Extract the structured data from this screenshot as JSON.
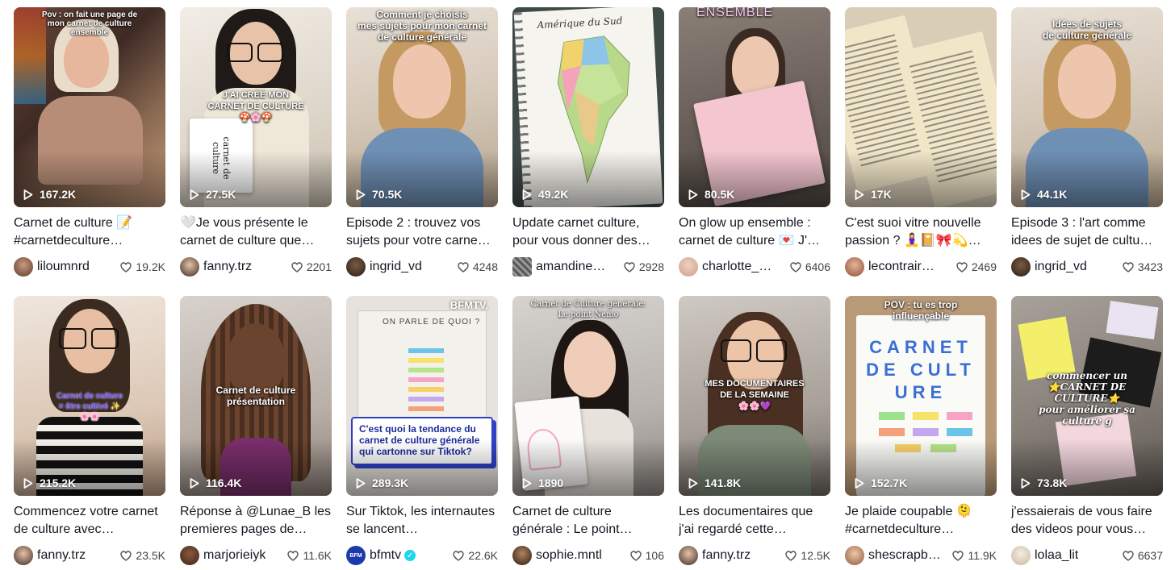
{
  "videos": [
    {
      "caption": "Carnet de culture 📝 #carnetdeculture…",
      "author": "liloumnrd",
      "likes": "19.2K",
      "views": "167.2K",
      "overlay": "Pov : on fait une page de\nmon carnet de culture\nensemble"
    },
    {
      "caption": "🤍Je vous présente le carnet de culture que…",
      "author": "fanny.trz",
      "likes": "2201",
      "views": "27.5K",
      "overlay": "J'AI CRÉÉ MON\nCARNET DE CULTURE\n🍄🌸🍄",
      "notebook_text": "carnet de culture"
    },
    {
      "caption": "Episode 2 : trouvez vos sujets pour votre carne…",
      "author": "ingrid_vd",
      "likes": "4248",
      "views": "70.5K",
      "overlay": "Comment je choisis\nmes sujets pour mon carnet\nde culture générale"
    },
    {
      "caption": "Update carnet culture, pour vous donner des…",
      "author": "amandine…",
      "likes": "2928",
      "views": "49.2K",
      "overlay": "Amérique du Sud"
    },
    {
      "caption": "On glow up ensemble : carnet de culture 💌 J'…",
      "author": "charlotte_s…",
      "likes": "6406",
      "views": "80.5K",
      "overlay": "ENSEMBLE"
    },
    {
      "caption": "C'est suoi vitre nouvelle passion ? 🧘‍♀️📔🎀💫…",
      "author": "lecontraire…",
      "likes": "2469",
      "views": "17K",
      "overlay": ""
    },
    {
      "caption": "Episode 3 : l'art comme idees de sujet de cultu…",
      "author": "ingrid_vd",
      "likes": "3423",
      "views": "44.1K",
      "overlay": "Idées de sujets\nde culture générale"
    },
    {
      "caption": "Commencez votre carnet de culture avec…",
      "author": "fanny.trz",
      "likes": "23.5K",
      "views": "215.2K",
      "overlay": "Carnet de culture\n= être cultivé ✨\n🌸🌸"
    },
    {
      "caption": "Réponse à @Lunae_B les premieres pages de…",
      "author": "marjorieiyk",
      "likes": "11.6K",
      "views": "116.4K",
      "overlay": "Carnet de culture\nprésentation"
    },
    {
      "caption": "Sur Tiktok, les internautes se lancent…",
      "author": "bfmtv",
      "likes": "22.6K",
      "views": "289.3K",
      "overlay": "C'est quoi la tendance du\ncarnet de culture générale\nqui cartonne sur Tiktok?",
      "verified": true,
      "brand": "BFMTV.",
      "board_text": "ON PARLE DE QUOI ?"
    },
    {
      "caption": "Carnet de culture générale : Le point…",
      "author": "sophie.mntl",
      "likes": "106",
      "views": "1890",
      "overlay": "Carnet de Culture générale:\nLe point Nemo"
    },
    {
      "caption": "Les documentaires que j'ai regardé cette…",
      "author": "fanny.trz",
      "likes": "12.5K",
      "views": "141.8K",
      "overlay": "MES DOCUMENTAIRES\nDE LA SEMAINE\n🌸🌸💜"
    },
    {
      "caption": "Je plaide coupable 🫠 #carnetdeculture…",
      "author": "shescrapb…",
      "likes": "11.9K",
      "views": "152.7K",
      "overlay": "POV : tu es trop\ninfluençable",
      "notebook_text": "CARNET DE CULTURE"
    },
    {
      "caption": "j'essaierais de vous faire des videos pour vous…",
      "author": "lolaa_lit",
      "likes": "6637",
      "views": "73.8K",
      "overlay": "commencer un\n⭐CARNET DE CULTURE⭐\npour améliorer sa culture g"
    }
  ],
  "colors": {
    "text": "#161823",
    "muted": "#444444",
    "verified": "#20d5ec",
    "bfm_blue": "#3040c8"
  },
  "icons": {
    "views": "play-icon",
    "likes": "heart-icon",
    "verified": "checkmark-badge-icon"
  }
}
